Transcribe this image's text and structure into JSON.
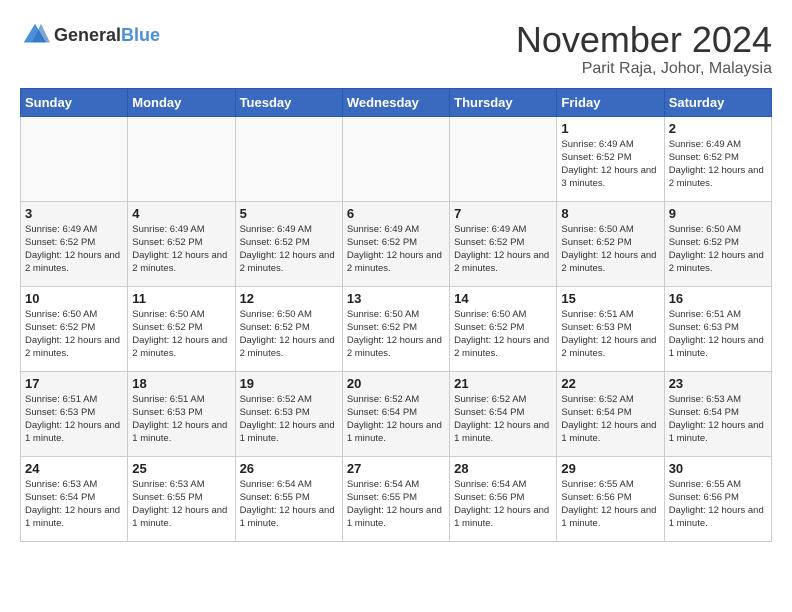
{
  "header": {
    "logo": {
      "general": "General",
      "blue": "Blue"
    },
    "title": "November 2024",
    "location": "Parit Raja, Johor, Malaysia"
  },
  "days_of_week": [
    "Sunday",
    "Monday",
    "Tuesday",
    "Wednesday",
    "Thursday",
    "Friday",
    "Saturday"
  ],
  "weeks": [
    [
      {
        "day": "",
        "info": ""
      },
      {
        "day": "",
        "info": ""
      },
      {
        "day": "",
        "info": ""
      },
      {
        "day": "",
        "info": ""
      },
      {
        "day": "",
        "info": ""
      },
      {
        "day": "1",
        "info": "Sunrise: 6:49 AM\nSunset: 6:52 PM\nDaylight: 12 hours and 3 minutes."
      },
      {
        "day": "2",
        "info": "Sunrise: 6:49 AM\nSunset: 6:52 PM\nDaylight: 12 hours and 2 minutes."
      }
    ],
    [
      {
        "day": "3",
        "info": "Sunrise: 6:49 AM\nSunset: 6:52 PM\nDaylight: 12 hours and 2 minutes."
      },
      {
        "day": "4",
        "info": "Sunrise: 6:49 AM\nSunset: 6:52 PM\nDaylight: 12 hours and 2 minutes."
      },
      {
        "day": "5",
        "info": "Sunrise: 6:49 AM\nSunset: 6:52 PM\nDaylight: 12 hours and 2 minutes."
      },
      {
        "day": "6",
        "info": "Sunrise: 6:49 AM\nSunset: 6:52 PM\nDaylight: 12 hours and 2 minutes."
      },
      {
        "day": "7",
        "info": "Sunrise: 6:49 AM\nSunset: 6:52 PM\nDaylight: 12 hours and 2 minutes."
      },
      {
        "day": "8",
        "info": "Sunrise: 6:50 AM\nSunset: 6:52 PM\nDaylight: 12 hours and 2 minutes."
      },
      {
        "day": "9",
        "info": "Sunrise: 6:50 AM\nSunset: 6:52 PM\nDaylight: 12 hours and 2 minutes."
      }
    ],
    [
      {
        "day": "10",
        "info": "Sunrise: 6:50 AM\nSunset: 6:52 PM\nDaylight: 12 hours and 2 minutes."
      },
      {
        "day": "11",
        "info": "Sunrise: 6:50 AM\nSunset: 6:52 PM\nDaylight: 12 hours and 2 minutes."
      },
      {
        "day": "12",
        "info": "Sunrise: 6:50 AM\nSunset: 6:52 PM\nDaylight: 12 hours and 2 minutes."
      },
      {
        "day": "13",
        "info": "Sunrise: 6:50 AM\nSunset: 6:52 PM\nDaylight: 12 hours and 2 minutes."
      },
      {
        "day": "14",
        "info": "Sunrise: 6:50 AM\nSunset: 6:52 PM\nDaylight: 12 hours and 2 minutes."
      },
      {
        "day": "15",
        "info": "Sunrise: 6:51 AM\nSunset: 6:53 PM\nDaylight: 12 hours and 2 minutes."
      },
      {
        "day": "16",
        "info": "Sunrise: 6:51 AM\nSunset: 6:53 PM\nDaylight: 12 hours and 1 minute."
      }
    ],
    [
      {
        "day": "17",
        "info": "Sunrise: 6:51 AM\nSunset: 6:53 PM\nDaylight: 12 hours and 1 minute."
      },
      {
        "day": "18",
        "info": "Sunrise: 6:51 AM\nSunset: 6:53 PM\nDaylight: 12 hours and 1 minute."
      },
      {
        "day": "19",
        "info": "Sunrise: 6:52 AM\nSunset: 6:53 PM\nDaylight: 12 hours and 1 minute."
      },
      {
        "day": "20",
        "info": "Sunrise: 6:52 AM\nSunset: 6:54 PM\nDaylight: 12 hours and 1 minute."
      },
      {
        "day": "21",
        "info": "Sunrise: 6:52 AM\nSunset: 6:54 PM\nDaylight: 12 hours and 1 minute."
      },
      {
        "day": "22",
        "info": "Sunrise: 6:52 AM\nSunset: 6:54 PM\nDaylight: 12 hours and 1 minute."
      },
      {
        "day": "23",
        "info": "Sunrise: 6:53 AM\nSunset: 6:54 PM\nDaylight: 12 hours and 1 minute."
      }
    ],
    [
      {
        "day": "24",
        "info": "Sunrise: 6:53 AM\nSunset: 6:54 PM\nDaylight: 12 hours and 1 minute."
      },
      {
        "day": "25",
        "info": "Sunrise: 6:53 AM\nSunset: 6:55 PM\nDaylight: 12 hours and 1 minute."
      },
      {
        "day": "26",
        "info": "Sunrise: 6:54 AM\nSunset: 6:55 PM\nDaylight: 12 hours and 1 minute."
      },
      {
        "day": "27",
        "info": "Sunrise: 6:54 AM\nSunset: 6:55 PM\nDaylight: 12 hours and 1 minute."
      },
      {
        "day": "28",
        "info": "Sunrise: 6:54 AM\nSunset: 6:56 PM\nDaylight: 12 hours and 1 minute."
      },
      {
        "day": "29",
        "info": "Sunrise: 6:55 AM\nSunset: 6:56 PM\nDaylight: 12 hours and 1 minute."
      },
      {
        "day": "30",
        "info": "Sunrise: 6:55 AM\nSunset: 6:56 PM\nDaylight: 12 hours and 1 minute."
      }
    ]
  ]
}
